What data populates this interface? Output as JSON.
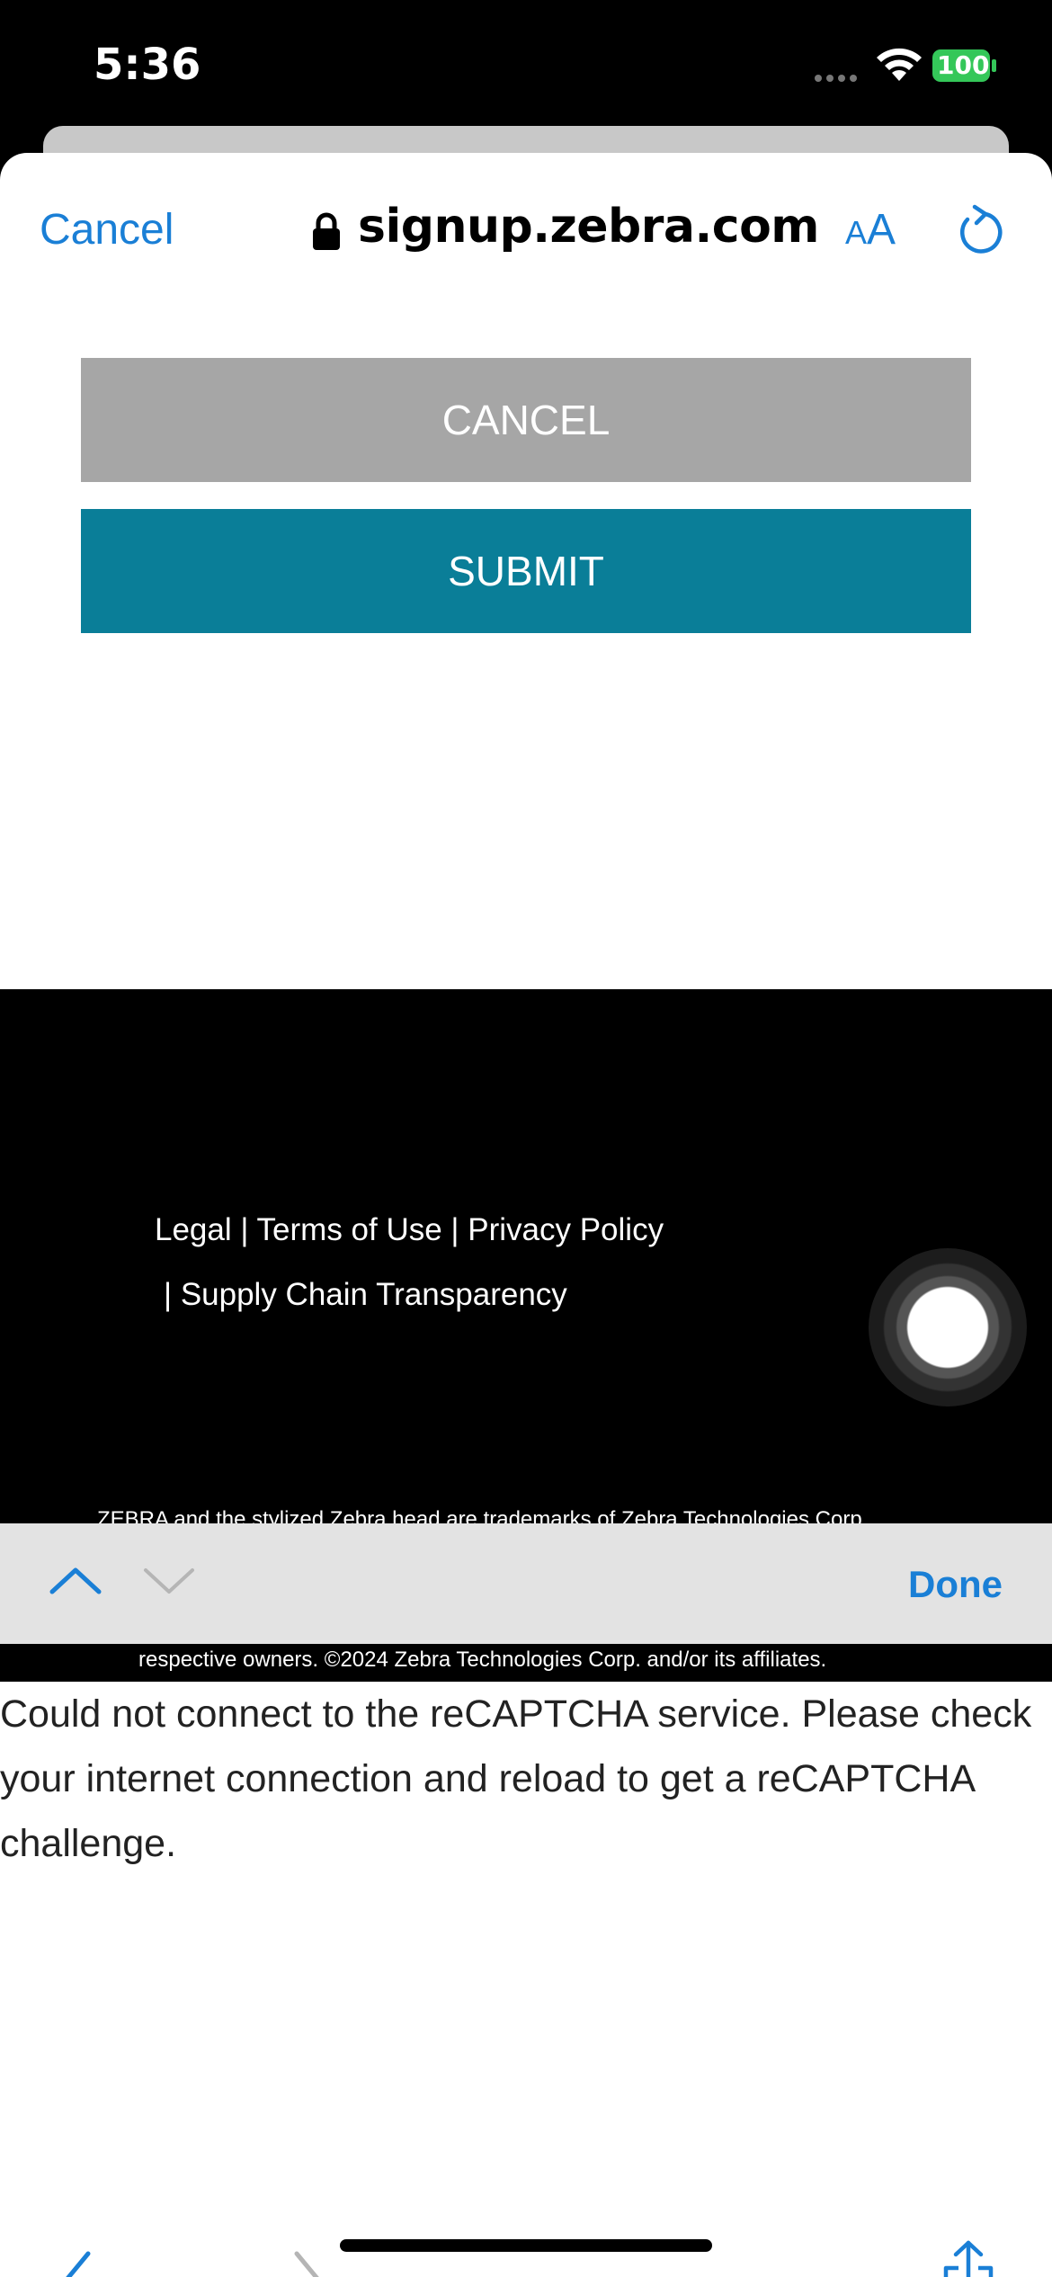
{
  "status_bar": {
    "time": "5:36",
    "battery": "100"
  },
  "browser": {
    "cancel_label": "Cancel",
    "url": "signup.zebra.com",
    "text_size_small": "A",
    "text_size_large": "A"
  },
  "form": {
    "cancel_label": "CANCEL",
    "submit_label": "SUBMIT"
  },
  "footer": {
    "links_line1": "Legal | Terms of Use | Privacy Policy",
    "links_line2": "| Supply Chain Transparency",
    "legal_line1": "ZEBRA and the stylized Zebra head are trademarks of Zebra Technologies Corp.",
    "legal_line2": "respective owners.  ©2024 Zebra Technologies Corp. and/or its affiliates."
  },
  "find_bar": {
    "done_label": "Done"
  },
  "captcha_message": "Could not connect to the reCAPTCHA service. Please check your internet connection and reload to get a reCAPTCHA challenge.",
  "colors": {
    "accent": "#1a7fd6",
    "submit_bg": "#0a7e98",
    "cancel_bg": "#a6a6a6",
    "battery": "#34c759"
  }
}
